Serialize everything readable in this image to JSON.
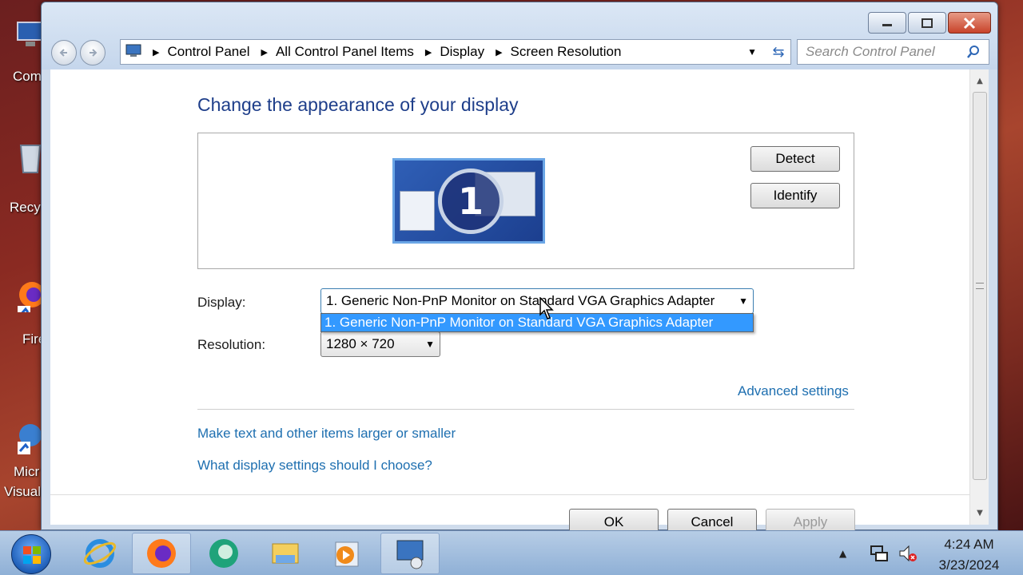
{
  "desktop": {
    "icons": [
      {
        "label": "Com",
        "icon": "computer-icon"
      },
      {
        "label": "Recy",
        "icon": "recycle-bin-icon"
      },
      {
        "label": "Fire",
        "icon": "firefox-icon"
      },
      {
        "label": "Micr",
        "label2": "Visual",
        "icon": "visual-studio-icon"
      }
    ]
  },
  "window": {
    "caption_buttons": [
      "minimize",
      "maximize",
      "close"
    ],
    "breadcrumb": [
      "Control Panel",
      "All Control Panel Items",
      "Display",
      "Screen Resolution"
    ],
    "search_placeholder": "Search Control Panel"
  },
  "page": {
    "title": "Change the appearance of your display",
    "monitor_number": "1",
    "detect_label": "Detect",
    "identify_label": "Identify",
    "display_label": "Display:",
    "display_value": "1. Generic Non-PnP Monitor on Standard VGA Graphics Adapter",
    "display_options": [
      "1. Generic Non-PnP Monitor on Standard VGA Graphics Adapter"
    ],
    "resolution_label": "Resolution:",
    "resolution_value": "1280 × 720",
    "advanced_link": "Advanced settings",
    "link_text_size": "Make text and other items larger or smaller",
    "link_help": "What display settings should I choose?",
    "ok_label": "OK",
    "cancel_label": "Cancel",
    "apply_label": "Apply"
  },
  "taskbar": {
    "apps": [
      "internet-explorer-icon",
      "firefox-icon",
      "edge-icon",
      "file-explorer-icon",
      "media-player-icon",
      "control-panel-icon"
    ],
    "time": "4:24 AM",
    "date": "3/23/2024"
  },
  "colors": {
    "heading": "#1e3e8a",
    "link": "#1e6fb0",
    "selection": "#3399ff"
  }
}
